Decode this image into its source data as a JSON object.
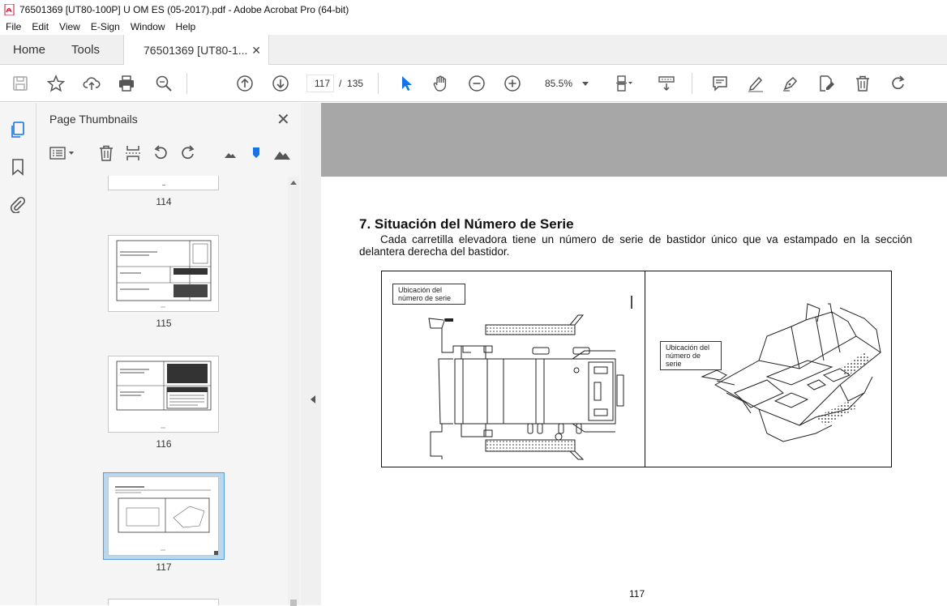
{
  "window": {
    "title": "76501369 [UT80-100P] U OM ES (05-2017).pdf - Adobe Acrobat Pro (64-bit)"
  },
  "menu": [
    "File",
    "Edit",
    "View",
    "E-Sign",
    "Window",
    "Help"
  ],
  "tabs": {
    "home": "Home",
    "tools": "Tools",
    "document": "76501369 [UT80-1..."
  },
  "toolbar": {
    "current_page": "117",
    "page_separator": "/",
    "total_pages": "135",
    "zoom": "85.5%"
  },
  "thumbnails_panel": {
    "title": "Page Thumbnails",
    "pages": [
      {
        "label": "114"
      },
      {
        "label": "115"
      },
      {
        "label": "116"
      },
      {
        "label": "117",
        "selected": true
      }
    ]
  },
  "document": {
    "heading": "7. Situación del Número de Serie",
    "paragraph": "Cada carretilla elevadora tiene un número de serie de bastidor único que va estampado en la sección delantera derecha del bastidor.",
    "callout_left": "Ubicación del número de serie",
    "callout_right": "Ubicación del número de serie",
    "page_number": "117"
  },
  "colors": {
    "accent_blue": "#1473e6",
    "doc_gray": "#a7a7a7",
    "selection_blue": "#b9d7ef"
  }
}
